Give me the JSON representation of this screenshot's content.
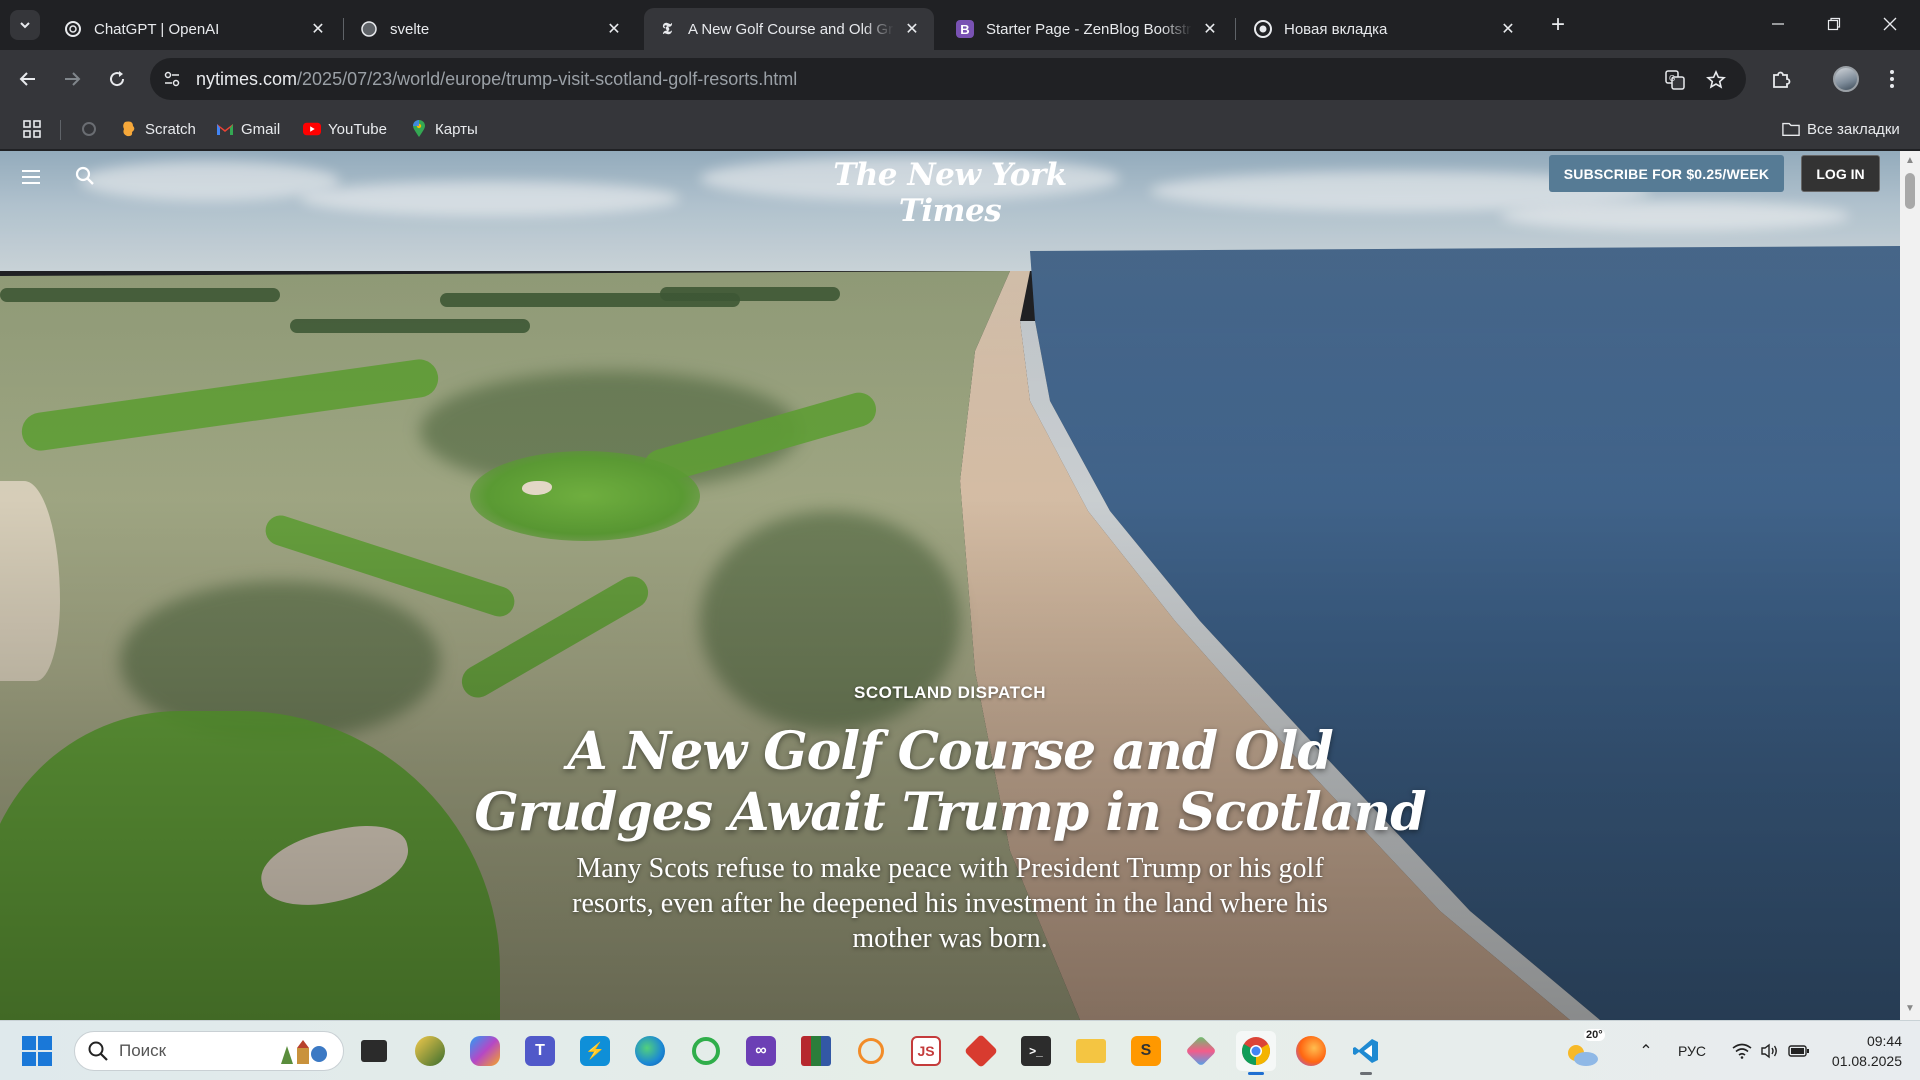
{
  "browser": {
    "tabs": [
      {
        "title": "ChatGPT | OpenAI",
        "favicon": "openai-icon",
        "active": false
      },
      {
        "title": "svelte",
        "favicon": "openai-icon",
        "active": false
      },
      {
        "title": "A New Golf Course and Old Gru",
        "favicon": "nyt-icon",
        "active": true
      },
      {
        "title": "Starter Page - ZenBlog Bootstra",
        "favicon": "bootstrap-icon",
        "active": false
      },
      {
        "title": "Новая вкладка",
        "favicon": "chrome-icon",
        "active": false
      }
    ],
    "url_host": "nytimes.com",
    "url_path": "/2025/07/23/world/europe/trump-visit-scotland-golf-resorts.html",
    "bookmarks": [
      {
        "label": "Scratch",
        "icon": "scratch-icon"
      },
      {
        "label": "Gmail",
        "icon": "gmail-icon"
      },
      {
        "label": "YouTube",
        "icon": "youtube-icon"
      },
      {
        "label": "Карты",
        "icon": "maps-icon"
      }
    ],
    "all_bookmarks_label": "Все закладки"
  },
  "nyt": {
    "logo": "The New York Times",
    "subscribe_label": "SUBSCRIBE FOR $0.25/WEEK",
    "login_label": "LOG IN",
    "kicker": "SCOTLAND DISPATCH",
    "headline": "A New Golf Course and Old Grudges Await Trump in Scotland",
    "summary": "Many Scots refuse to make peace with President Trump or his golf resorts, even after he deepened his investment in the land where his mother was born."
  },
  "taskbar": {
    "search_placeholder": "Поиск",
    "apps": [
      "file-explorer-icon",
      "weather-app-icon",
      "copilot-icon",
      "teams-icon",
      "power-automate-icon",
      "edge-icon",
      "green-app-icon",
      "visual-studio-icon",
      "winrar-icon",
      "orange-app-icon",
      "scratch-desktop-icon",
      "git-icon",
      "terminal-icon",
      "folder-icon",
      "sublime-icon",
      "colorful-app-icon",
      "chrome-icon",
      "firefox-icon",
      "vscode-icon"
    ],
    "weather_temp": "20°",
    "language": "РУС",
    "time": "09:44",
    "date": "01.08.2025"
  },
  "colors": {
    "accent_blue": "#1a78d8",
    "nyt_subscribe": "#567b95"
  }
}
